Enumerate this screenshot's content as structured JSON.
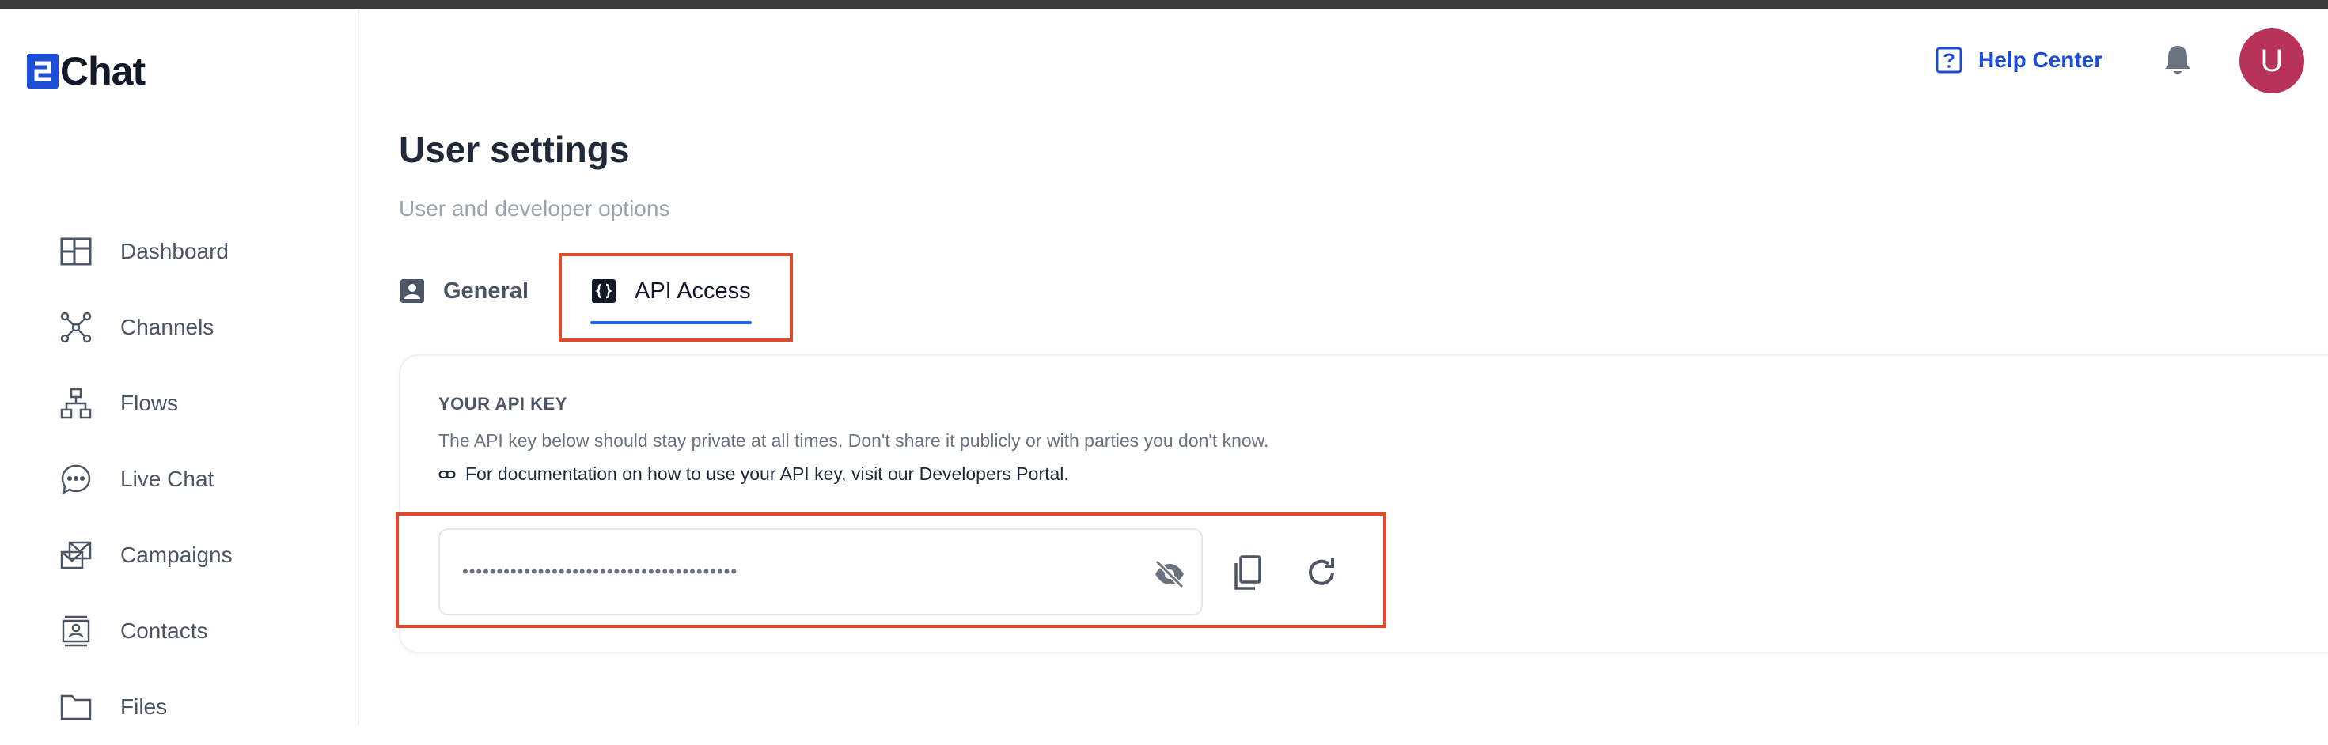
{
  "app": {
    "name": "Chat",
    "brand_color": "#1d4ed8",
    "accent_color": "#2563eb",
    "highlight_color": "#e04a2f"
  },
  "sidebar": {
    "items": [
      {
        "label": "Dashboard",
        "icon": "dashboard-icon"
      },
      {
        "label": "Channels",
        "icon": "channels-icon"
      },
      {
        "label": "Flows",
        "icon": "flows-icon"
      },
      {
        "label": "Live Chat",
        "icon": "chat-bubble-icon"
      },
      {
        "label": "Campaigns",
        "icon": "campaigns-icon"
      },
      {
        "label": "Contacts",
        "icon": "contacts-icon"
      },
      {
        "label": "Files",
        "icon": "folder-icon"
      }
    ]
  },
  "header": {
    "help_center": "Help Center",
    "avatar_initial": "U",
    "avatar_color": "#b8325a"
  },
  "main": {
    "title": "User settings",
    "subtitle": "User and developer options",
    "tabs": [
      {
        "label": "General",
        "icon": "user-card-icon",
        "active": false
      },
      {
        "label": "API Access",
        "icon": "code-braces-icon",
        "active": true
      }
    ],
    "api_card": {
      "heading": "YOUR API KEY",
      "description": "The API key below should stay private at all times. Don't share it publicly or with parties you don't know.",
      "doc_text": "For documentation on how to use your API key, visit our Developers Portal.",
      "key_masked": "••••••••••••••••••••••••••••••••••••••••"
    }
  }
}
